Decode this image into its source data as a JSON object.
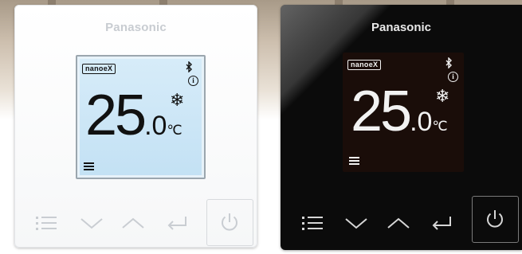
{
  "white_unit": {
    "brand": "Panasonic",
    "display": {
      "badge": "nanoeX",
      "temperature_integer": "25",
      "temperature_decimal": ".0",
      "temperature_unit": "℃",
      "bluetooth_icon": "bluetooth-icon",
      "info_icon": "info-icon",
      "fan_icon": "snowflake-icon",
      "menu_icon": "list-icon"
    },
    "buttons": [
      "menu-button",
      "down-button",
      "up-button",
      "enter-button",
      "power-button"
    ]
  },
  "black_unit": {
    "brand": "Panasonic",
    "display": {
      "badge": "nanoeX",
      "temperature_integer": "25",
      "temperature_decimal": ".0",
      "temperature_unit": "℃",
      "bluetooth_icon": "bluetooth-icon",
      "info_icon": "info-icon",
      "fan_icon": "snowflake-icon",
      "menu_icon": "list-icon"
    },
    "buttons": [
      "menu-button",
      "down-button",
      "up-button",
      "enter-button",
      "power-button"
    ]
  },
  "colors": {
    "white_face": "#f8f9fa",
    "black_face": "#0b0b0b",
    "lcd_white_bg": "#cfe7f7",
    "lcd_black_bg": "#1a0d09"
  }
}
